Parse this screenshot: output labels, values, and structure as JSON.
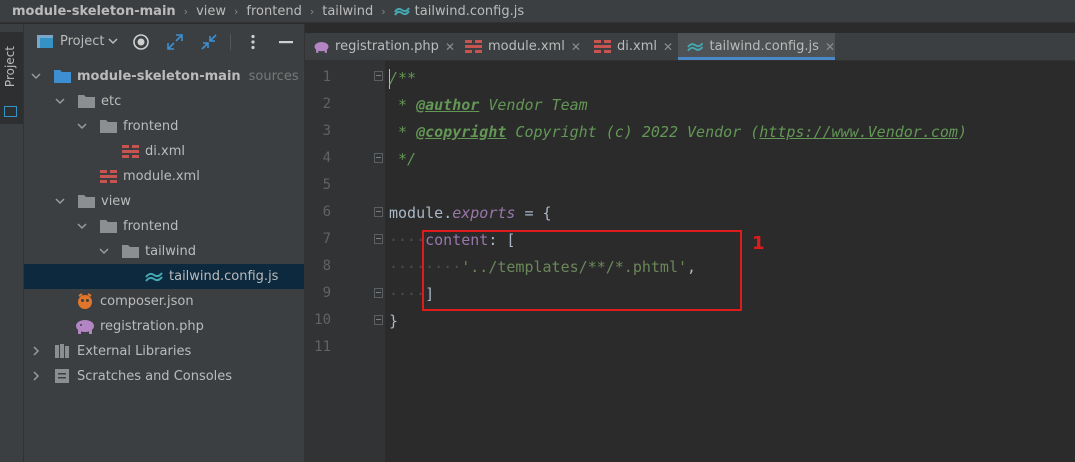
{
  "breadcrumb": [
    "module-skeleton-main",
    "view",
    "frontend",
    "tailwind",
    "tailwind.config.js"
  ],
  "sidebar_tab": {
    "label": "Project"
  },
  "project_panel": {
    "title": "Project",
    "tree": [
      {
        "label": "module-skeleton-main",
        "suffix": "sources roo",
        "icon": "folder-icon",
        "arrow": "expanded"
      },
      {
        "label": "etc",
        "icon": "folder-icon",
        "arrow": "expanded"
      },
      {
        "label": "frontend",
        "icon": "folder-icon",
        "arrow": "expanded"
      },
      {
        "label": "di.xml",
        "icon": "xml-file-icon"
      },
      {
        "label": "module.xml",
        "icon": "xml-file-icon"
      },
      {
        "label": "view",
        "icon": "folder-icon",
        "arrow": "expanded"
      },
      {
        "label": "frontend",
        "icon": "folder-icon",
        "arrow": "expanded"
      },
      {
        "label": "tailwind",
        "icon": "folder-icon",
        "arrow": "expanded"
      },
      {
        "label": "tailwind.config.js",
        "icon": "tailwind-file-icon",
        "selected": true
      },
      {
        "label": "composer.json",
        "icon": "composer-file-icon"
      },
      {
        "label": "registration.php",
        "icon": "php-file-icon"
      },
      {
        "label": "External Libraries",
        "icon": "library-icon",
        "arrow": "collapsed"
      },
      {
        "label": "Scratches and Consoles",
        "icon": "scratches-icon",
        "arrow": "collapsed"
      }
    ]
  },
  "tabs": [
    {
      "label": "registration.php",
      "icon": "php-file-icon",
      "active": false
    },
    {
      "label": "module.xml",
      "icon": "xml-file-icon",
      "active": false
    },
    {
      "label": "di.xml",
      "icon": "xml-file-icon",
      "active": false
    },
    {
      "label": "tailwind.config.js",
      "icon": "tailwind-file-icon",
      "active": true
    }
  ],
  "close_glyph": "✕",
  "editor": {
    "line_numbers": [
      "1",
      "2",
      "3",
      "4",
      "5",
      "6",
      "7",
      "8",
      "9",
      "10",
      "11"
    ],
    "code": {
      "l1": "/**",
      "l2_star": " * ",
      "l2_tag": "@author",
      "l2_text": " Vendor Team",
      "l3_star": " * ",
      "l3_tag": "@copyright",
      "l3_text": " Copyright (c) 2022 Vendor (",
      "l3_link": "https://www.Vendor.com",
      "l3_end": ")",
      "l4": " */",
      "l6_obj": "module",
      "l6_dot": ".",
      "l6_prop": "exports",
      "l6_rest": " = {",
      "l7_ws": "····",
      "l7_key": "content",
      "l7_rest": ": [",
      "l8_ws": "········",
      "l8_str": "'../templates/**/*.phtml'",
      "l8_rest": ",",
      "l9_ws": "····",
      "l9_rest": "]",
      "l10": "}"
    }
  },
  "annotation": {
    "label": "1",
    "color": "#e01b1b"
  },
  "colors": {
    "accent": "#4a88c7",
    "selection": "#0d293e",
    "doc_comment": "#629755",
    "string": "#6a8759",
    "property": "#9876aa"
  }
}
